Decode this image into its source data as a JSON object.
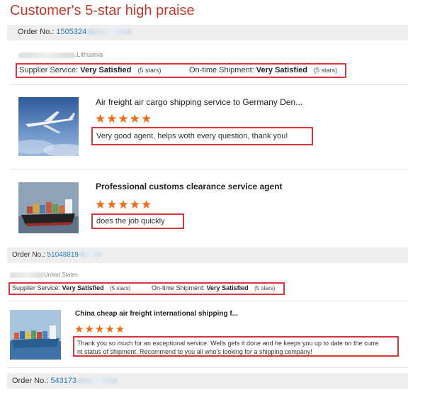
{
  "page": {
    "title": "Customer's 5-star high praise"
  },
  "colors": {
    "title": "#c0392b",
    "order_number": "#2a7bbf",
    "stars": "#ee6a14",
    "highlight_box": "#d9363e"
  },
  "orders": [
    {
      "order_label": "Order No.:",
      "order_number": "1505324",
      "location": ",Lithuania",
      "supplier_label": "Supplier Service:",
      "supplier_value": "Very Satisfied",
      "supplier_stars": "(5 stars)",
      "shipment_label": "On-time Shipment:",
      "shipment_value": "Very Satisfied",
      "shipment_stars": "(5 stars)",
      "products": [
        {
          "title": "Air freight air cargo shipping service to Germany Den...",
          "rating": 5,
          "stars": "★★★★★",
          "review": "Very good agent, helps woth every question, thank you!",
          "image": "airplane-photo"
        },
        {
          "title": "Professional customs clearance service agent",
          "rating": 5,
          "stars": "★★★★★",
          "review": "does the job quickly",
          "image": "container-ship-photo"
        }
      ]
    },
    {
      "order_label": "Order No.:",
      "order_number": "51048819",
      "location": "United States",
      "supplier_label": "Supplier Service:",
      "supplier_value": "Very Satisfied",
      "supplier_stars": "(5 stars)",
      "shipment_label": "On-time Shipment:",
      "shipment_value": "Very Satisfied",
      "shipment_stars": "(5 stars)",
      "products": [
        {
          "title": "China cheap air freight international shipping f...",
          "rating": 5,
          "stars": "★★★★★",
          "review_line1": "Thank you so much for an exceptional service. Wells gets it done and he keeps you up to date on the curre",
          "review_line2": "nt status of shipment. Recommend to you all who's looking for a shipping company!",
          "image": "cargo-ship-photo"
        }
      ]
    },
    {
      "order_label": "Order No.:",
      "order_number": "543173"
    }
  ]
}
